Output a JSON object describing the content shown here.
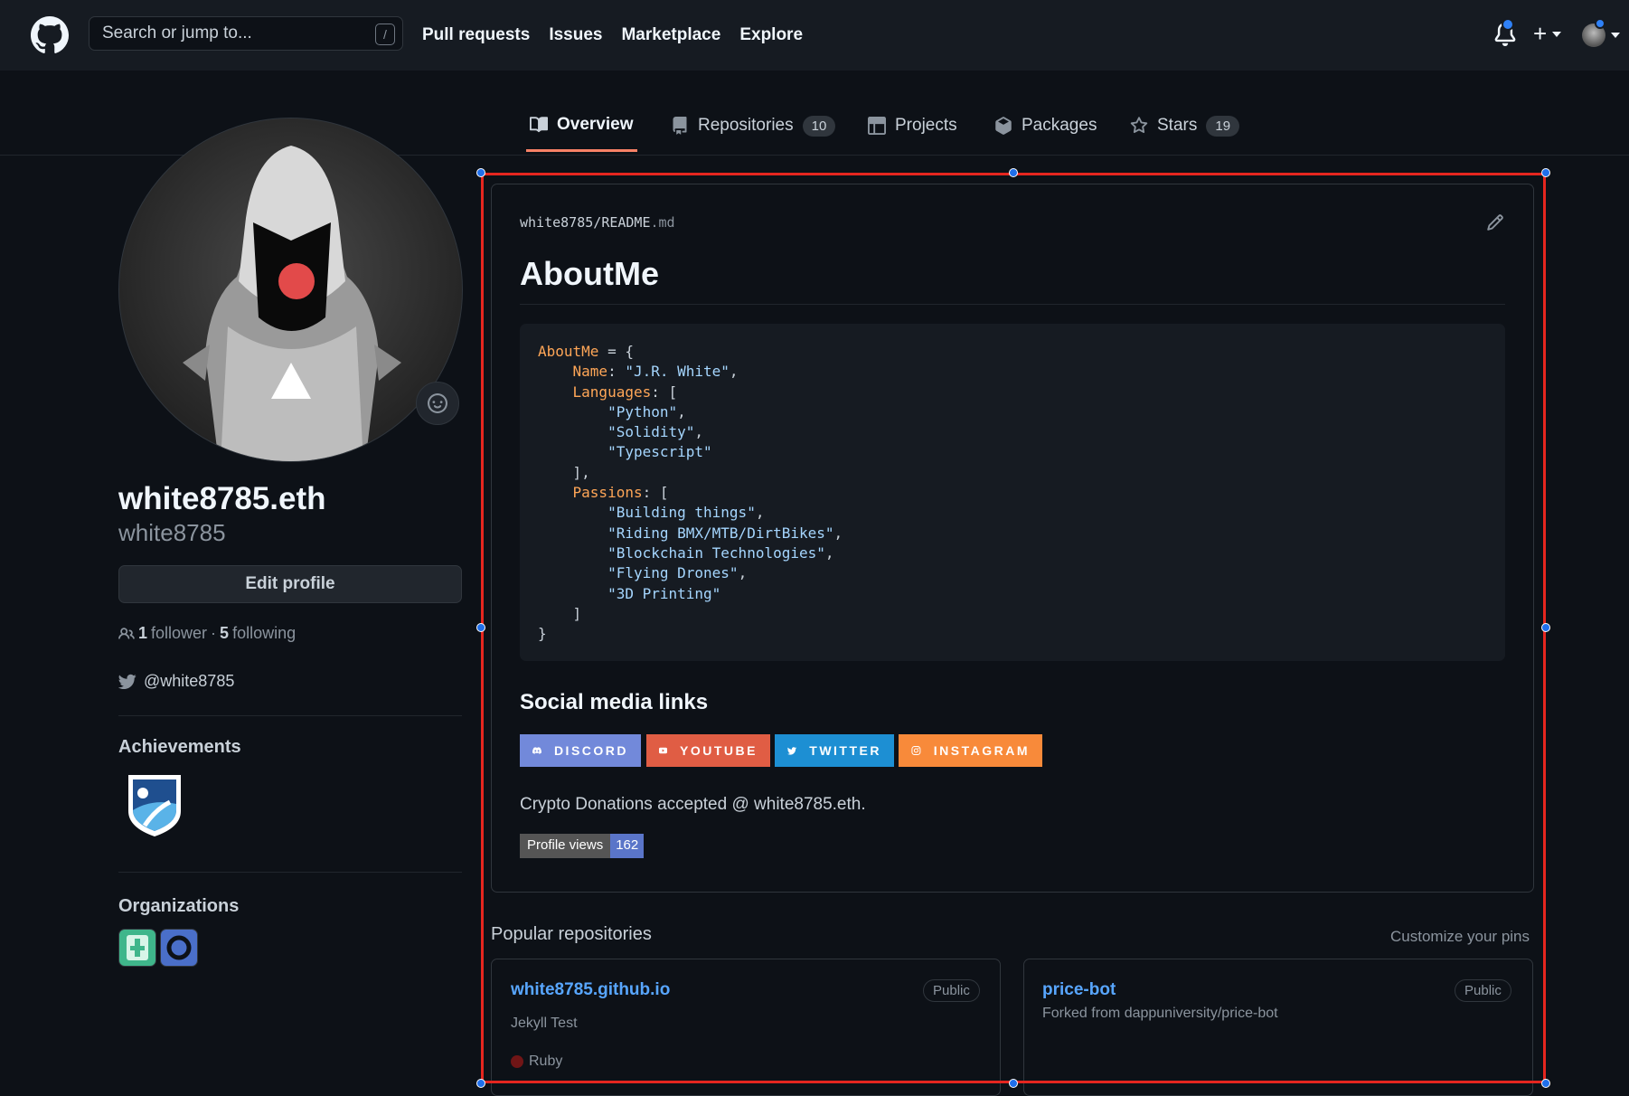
{
  "header": {
    "search_placeholder": "Search or jump to...",
    "search_shortcut": "/",
    "nav": [
      "Pull requests",
      "Issues",
      "Marketplace",
      "Explore"
    ],
    "plus": "+"
  },
  "tabs": [
    {
      "label": "Overview",
      "count": null,
      "active": true,
      "icon": "book-icon"
    },
    {
      "label": "Repositories",
      "count": "10",
      "active": false,
      "icon": "repo-icon"
    },
    {
      "label": "Projects",
      "count": null,
      "active": false,
      "icon": "table-icon"
    },
    {
      "label": "Packages",
      "count": null,
      "active": false,
      "icon": "package-icon"
    },
    {
      "label": "Stars",
      "count": "19",
      "active": false,
      "icon": "star-icon"
    }
  ],
  "profile": {
    "display_name": "white8785.eth",
    "login": "white8785",
    "edit_label": "Edit profile",
    "followers": "1",
    "followers_label": "follower",
    "sep": "·",
    "following": "5",
    "following_label": "following",
    "twitter": "@white8785",
    "achievements_heading": "Achievements",
    "organizations_heading": "Organizations"
  },
  "readme": {
    "owner": "white8785",
    "slash": "/",
    "file": "README",
    "ext": ".md",
    "title": "AboutMe",
    "code": [
      [
        [
          "k",
          "AboutMe"
        ],
        [
          "p",
          " = {"
        ]
      ],
      [
        [
          "p",
          "    "
        ],
        [
          "k",
          "Name"
        ],
        [
          "p",
          ": "
        ],
        [
          "s",
          "\"J.R. White\""
        ],
        [
          "p",
          ","
        ]
      ],
      [
        [
          "p",
          "    "
        ],
        [
          "k",
          "Languages"
        ],
        [
          "p",
          ": ["
        ]
      ],
      [
        [
          "p",
          "        "
        ],
        [
          "s",
          "\"Python\""
        ],
        [
          "p",
          ","
        ]
      ],
      [
        [
          "p",
          "        "
        ],
        [
          "s",
          "\"Solidity\""
        ],
        [
          "p",
          ","
        ]
      ],
      [
        [
          "p",
          "        "
        ],
        [
          "s",
          "\"Typescript\""
        ]
      ],
      [
        [
          "p",
          "    ],"
        ]
      ],
      [
        [
          "p",
          "    "
        ],
        [
          "k",
          "Passions"
        ],
        [
          "p",
          ": ["
        ]
      ],
      [
        [
          "p",
          "        "
        ],
        [
          "s",
          "\"Building things\""
        ],
        [
          "p",
          ","
        ]
      ],
      [
        [
          "p",
          "        "
        ],
        [
          "s",
          "\"Riding BMX/MTB/DirtBikes\""
        ],
        [
          "p",
          ","
        ]
      ],
      [
        [
          "p",
          "        "
        ],
        [
          "s",
          "\"Blockchain Technologies\""
        ],
        [
          "p",
          ","
        ]
      ],
      [
        [
          "p",
          "        "
        ],
        [
          "s",
          "\"Flying Drones\""
        ],
        [
          "p",
          ","
        ]
      ],
      [
        [
          "p",
          "        "
        ],
        [
          "s",
          "\"3D Printing\""
        ]
      ],
      [
        [
          "p",
          "    ]"
        ]
      ],
      [
        [
          "p",
          "}"
        ]
      ]
    ],
    "social_heading": "Social media links",
    "social": [
      {
        "label": "DISCORD",
        "color": "#7289da",
        "icon": "discord-icon"
      },
      {
        "label": "YOUTUBE",
        "color": "#e05d44",
        "icon": "youtube-icon"
      },
      {
        "label": "TWITTER",
        "color": "#1d8fd3",
        "icon": "twitter-icon"
      },
      {
        "label": "INSTAGRAM",
        "color": "#f88a3a",
        "icon": "instagram-icon"
      }
    ],
    "donations": "Crypto Donations accepted @ white8785.eth.",
    "profile_views_label": "Profile views",
    "profile_views_count": "162"
  },
  "popular": {
    "heading": "Popular repositories",
    "customize": "Customize your pins",
    "repos": [
      {
        "name": "white8785.github.io",
        "visibility": "Public",
        "desc": "Jekyll Test",
        "language": "Ruby",
        "lang_color": "#701516"
      },
      {
        "name": "price-bot",
        "visibility": "Public",
        "desc": "Forked from dappuniversity/price-bot",
        "language": "",
        "lang_color": ""
      }
    ]
  },
  "colors": {
    "accent": "#f78166",
    "link": "#58a6ff",
    "selection": "#e5261f"
  }
}
